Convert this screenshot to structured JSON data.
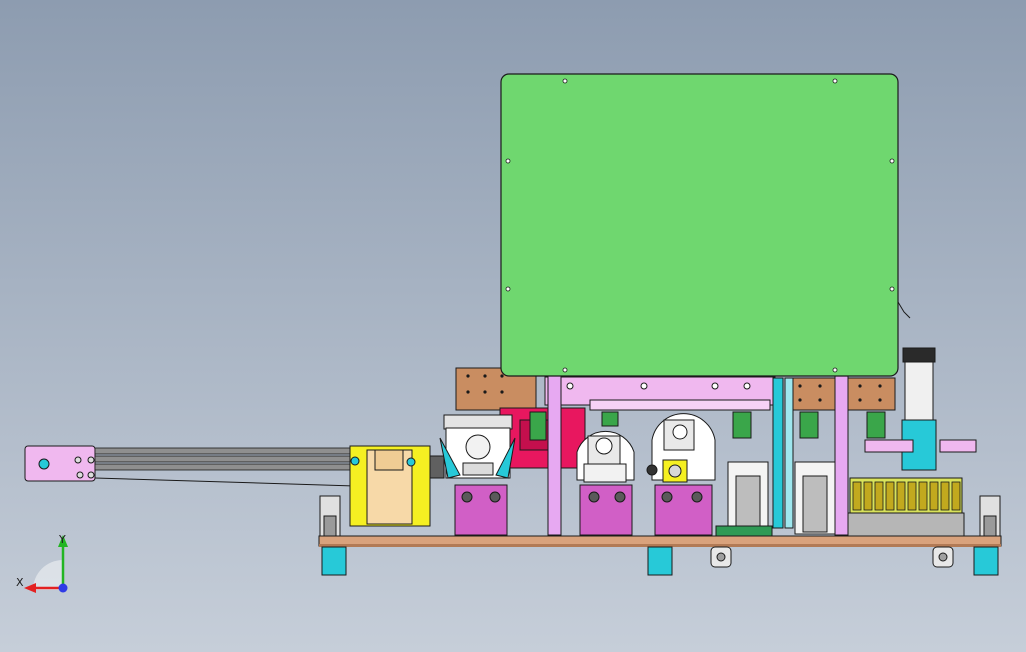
{
  "viewport": {
    "background_top": "#8d9cb0",
    "background_bottom": "#c6ced9"
  },
  "model": {
    "colors": {
      "cover_panel": "#6fd76f",
      "base_plate": "#d9a27c",
      "bracket_wood": "#c98d61",
      "magenta_block": "#d15fc6",
      "pink_frame": "#f0b8ef",
      "cyan_foot": "#27c9d8",
      "yellow_plate": "#f5f022",
      "beige_block": "#f7d9a8",
      "gray_rail": "#8f8f8f",
      "lavender_bar": "#e7a9f2",
      "outline": "#1a1a1a"
    }
  },
  "triad": {
    "x_label": "X",
    "y_label": "Y",
    "x_color": "#e32121",
    "y_color": "#22b522",
    "z_color": "#2f3be6"
  }
}
